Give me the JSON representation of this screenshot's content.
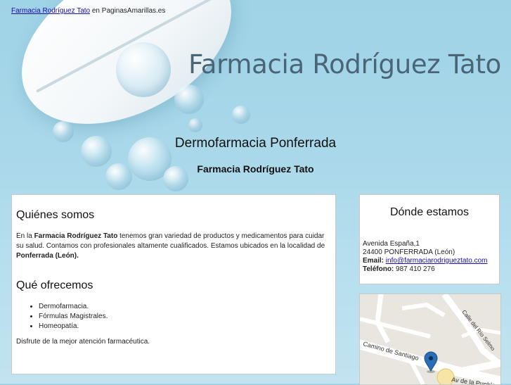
{
  "topbar": {
    "link_text": "Farmacia Rodríguez Tato",
    "suffix_text": " en PaginasAmarillas.es"
  },
  "brand": {
    "logo_text": "Farmacia Rodríguez Tato"
  },
  "headline": {
    "title": "Dermofarmacia Ponferrada",
    "subtitle": "Farmacia Rodríguez Tato"
  },
  "about": {
    "heading": "Quiénes somos",
    "p1_a": "En la ",
    "p1_b": "Farmacia Rodríguez Tato",
    "p1_c": " tenemos gran variedad de productos y medicamentos para cuidar su salud. Contamos con profesionales altamente cualificados. Estamos ubicados en la localidad de ",
    "p1_d": "Ponferrada (León)."
  },
  "offer": {
    "heading": "Qué ofrecemos",
    "items": [
      "Dermofarmacia.",
      "Fórmulas Magistrales.",
      "Homeopatía."
    ],
    "closing": "Disfrute de la mejor atención farmacéutica."
  },
  "location": {
    "heading": "Dónde estamos",
    "address": "Avenida España,1",
    "city": "24400 PONFERRADA (León)",
    "email_label": "Email:",
    "email_value": "info@farmaciarodrigueztato.com ",
    "phone_label": "Teléfono:",
    "phone_value": " 987 410 276"
  },
  "map": {
    "streets": [
      "Camino de Santiago",
      "Calle del Río Selmo",
      "Av de la Puebla"
    ],
    "marker_icon": "map-pin-icon",
    "colors": {
      "road": "#ffffff",
      "land": "#e9e6df",
      "marker": "#2a6fb6"
    }
  },
  "colors": {
    "link": "#1a0dab",
    "brand_text": "#4a6676",
    "background": "#a9d8ea"
  }
}
